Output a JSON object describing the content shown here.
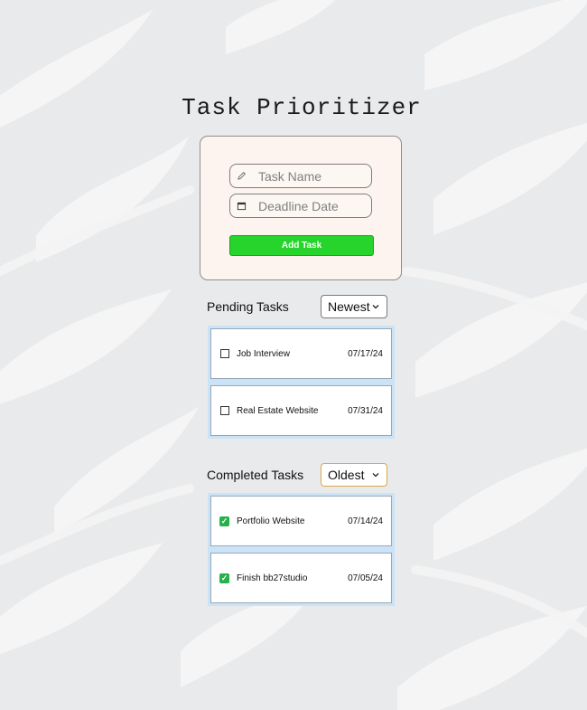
{
  "app": {
    "title": "Task Prioritizer"
  },
  "form": {
    "task_name_placeholder": "Task Name",
    "deadline_placeholder": "Deadline Date",
    "add_button_label": "Add Task",
    "name_icon": "pencil-icon",
    "date_icon": "calendar-icon"
  },
  "pending": {
    "label": "Pending Tasks",
    "sort_value": "Newest",
    "tasks": [
      {
        "name": "Job Interview",
        "date": "07/17/24",
        "done": false
      },
      {
        "name": "Real Estate Website",
        "date": "07/31/24",
        "done": false
      }
    ]
  },
  "completed": {
    "label": "Completed Tasks",
    "sort_value": "Oldest",
    "tasks": [
      {
        "name": "Portfolio Website",
        "date": "07/14/24",
        "done": true
      },
      {
        "name": "Finish bb27studio",
        "date": "07/05/24",
        "done": true
      }
    ]
  },
  "colors": {
    "accent_button": "#26d42b",
    "list_highlight": "#cbe3f7",
    "form_background": "#fdf4ef",
    "check_green": "#24b24a"
  }
}
